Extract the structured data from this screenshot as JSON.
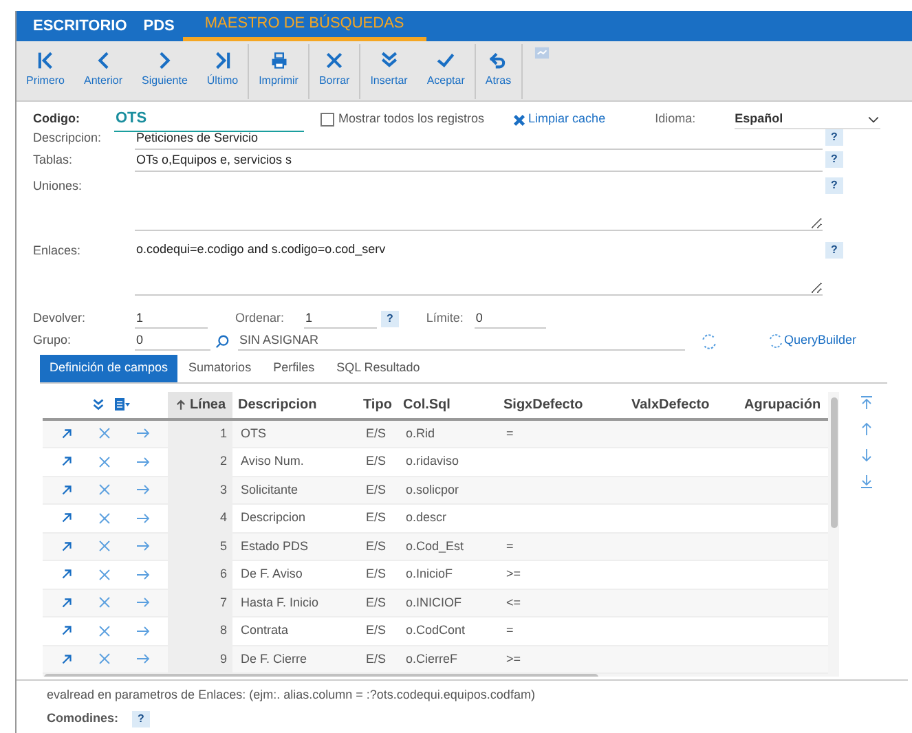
{
  "top_tabs": [
    {
      "label": "ESCRITORIO",
      "selected": false
    },
    {
      "label": "PDS",
      "selected": false
    },
    {
      "label": "MAESTRO DE BÚSQUEDAS",
      "selected": true
    }
  ],
  "toolbar": [
    "Primero",
    "Anterior",
    "Siguiente",
    "Último",
    "Imprimir",
    "Borrar",
    "Insertar",
    "Aceptar",
    "Atras"
  ],
  "form": {
    "codigo": {
      "label": "Codigo:",
      "value": "OTS"
    },
    "mostrar": {
      "label": "Mostrar todos los registros",
      "checked": false
    },
    "limpiar": "Limpiar cache",
    "idioma": {
      "label": "Idioma:",
      "value": "Español"
    },
    "descripcion": {
      "label": "Descripcion:",
      "value": "Peticiones de Servicio",
      "help": "?"
    },
    "tablas": {
      "label": "Tablas:",
      "value": "OTs o,Equipos e, servicios s",
      "help": "?"
    },
    "uniones": {
      "label": "Uniones:",
      "help": "?"
    },
    "enlaces": {
      "label": "Enlaces:",
      "value": "o.codequi=e.codigo and s.codigo=o.cod_serv",
      "help": "?"
    },
    "devolver": {
      "label": "Devolver:",
      "value": "1"
    },
    "ordenar": {
      "label": "Ordenar:",
      "value": "1",
      "help": "?"
    },
    "limite": {
      "label": "Límite:",
      "value": "0"
    },
    "grupo": {
      "label": "Grupo:",
      "value": "0",
      "name": "SIN ASIGNAR"
    },
    "querybuilder": "QueryBuilder"
  },
  "tabs": [
    {
      "label": "Definición de campos",
      "selected": true
    },
    {
      "label": "Sumatorios",
      "selected": false
    },
    {
      "label": "Perfiles",
      "selected": false
    },
    {
      "label": "SQL Resultado",
      "selected": false
    }
  ],
  "table": {
    "columns": [
      "Línea",
      "Descripcion",
      "Tipo",
      "Col.Sql",
      "SigxDefecto",
      "ValxDefecto",
      "Agrupación"
    ],
    "rows": [
      [
        "1",
        "OTS",
        "E/S",
        "o.Rid",
        "="
      ],
      [
        "2",
        "Aviso Num.",
        "E/S",
        "o.ridaviso",
        ""
      ],
      [
        "3",
        "Solicitante",
        "E/S",
        "o.solicpor",
        ""
      ],
      [
        "4",
        "Descripcion",
        "E/S",
        "o.descr",
        ""
      ],
      [
        "5",
        "Estado PDS",
        "E/S",
        "o.Cod_Est",
        "="
      ],
      [
        "6",
        "De F. Aviso",
        "E/S",
        "o.InicioF",
        ">="
      ],
      [
        "7",
        "Hasta F. Inicio",
        "E/S",
        "o.INICIOF",
        "<="
      ],
      [
        "8",
        "Contrata",
        "E/S",
        "o.CodCont",
        "="
      ],
      [
        "9",
        "De F. Cierre",
        "E/S",
        "o.CierreF",
        ">="
      ]
    ]
  },
  "note": "evalread en parametros de Enlaces: (ejm:. alias.column = :?ots.codequi.equipos.codfam)",
  "comodines": {
    "label": "Comodines:",
    "help": "?"
  }
}
